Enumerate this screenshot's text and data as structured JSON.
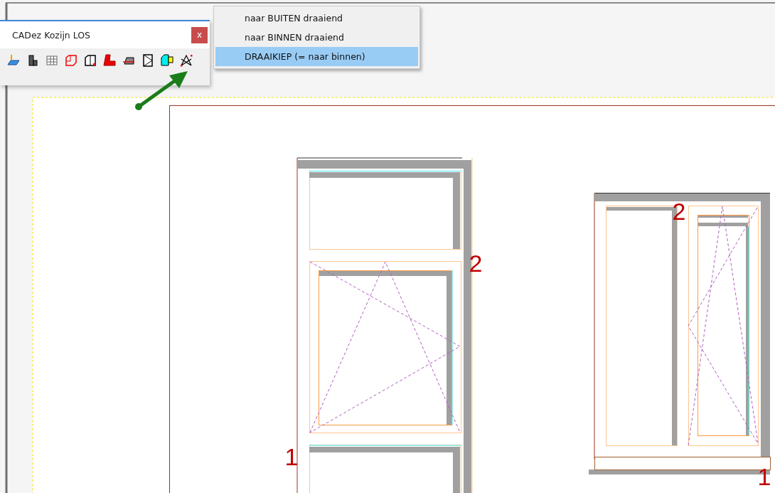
{
  "toolbar": {
    "title": "CADez Kozijn LOS",
    "close": "x"
  },
  "menu": {
    "items": [
      {
        "label": "naar BUITEN draaiend",
        "selected": false
      },
      {
        "label": "naar BINNEN draaiend",
        "selected": false
      },
      {
        "label": "DRAAIKIEP (= naar binnen)",
        "selected": true
      }
    ]
  },
  "drawing": {
    "windows": [
      {
        "marks": [
          "2",
          "1"
        ]
      },
      {
        "marks": [
          "2",
          "1"
        ]
      }
    ]
  }
}
